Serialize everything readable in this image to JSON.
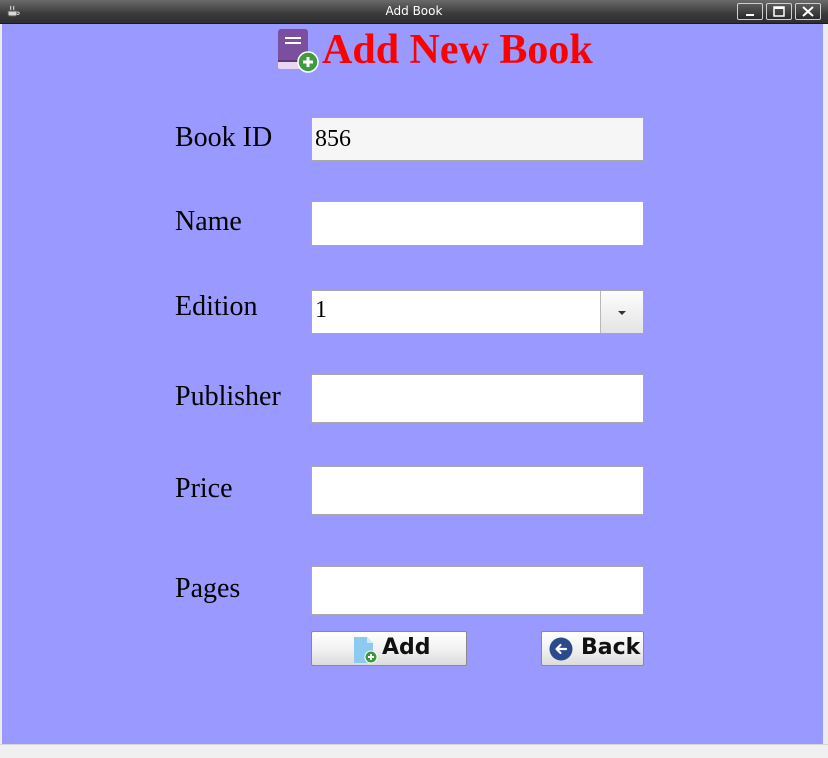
{
  "window": {
    "title": "Add Book",
    "controls": [
      "minimize-icon",
      "maximize-icon",
      "close-icon"
    ]
  },
  "heading": {
    "text": "Add New Book",
    "icon": "book-add-icon",
    "color": "#ff0000"
  },
  "colors": {
    "background": "#9999ff",
    "titlebar": "#3a3a3a"
  },
  "form": {
    "book_id": {
      "label": "Book ID",
      "value": "856"
    },
    "name": {
      "label": "Name",
      "value": ""
    },
    "edition": {
      "label": "Edition",
      "value": "1"
    },
    "publisher": {
      "label": "Publisher",
      "value": ""
    },
    "price": {
      "label": "Price",
      "value": ""
    },
    "pages": {
      "label": "Pages",
      "value": ""
    }
  },
  "buttons": {
    "add": {
      "label": "Add",
      "icon": "document-add-icon"
    },
    "back": {
      "label": "Back",
      "icon": "arrow-left-circle-icon"
    }
  }
}
